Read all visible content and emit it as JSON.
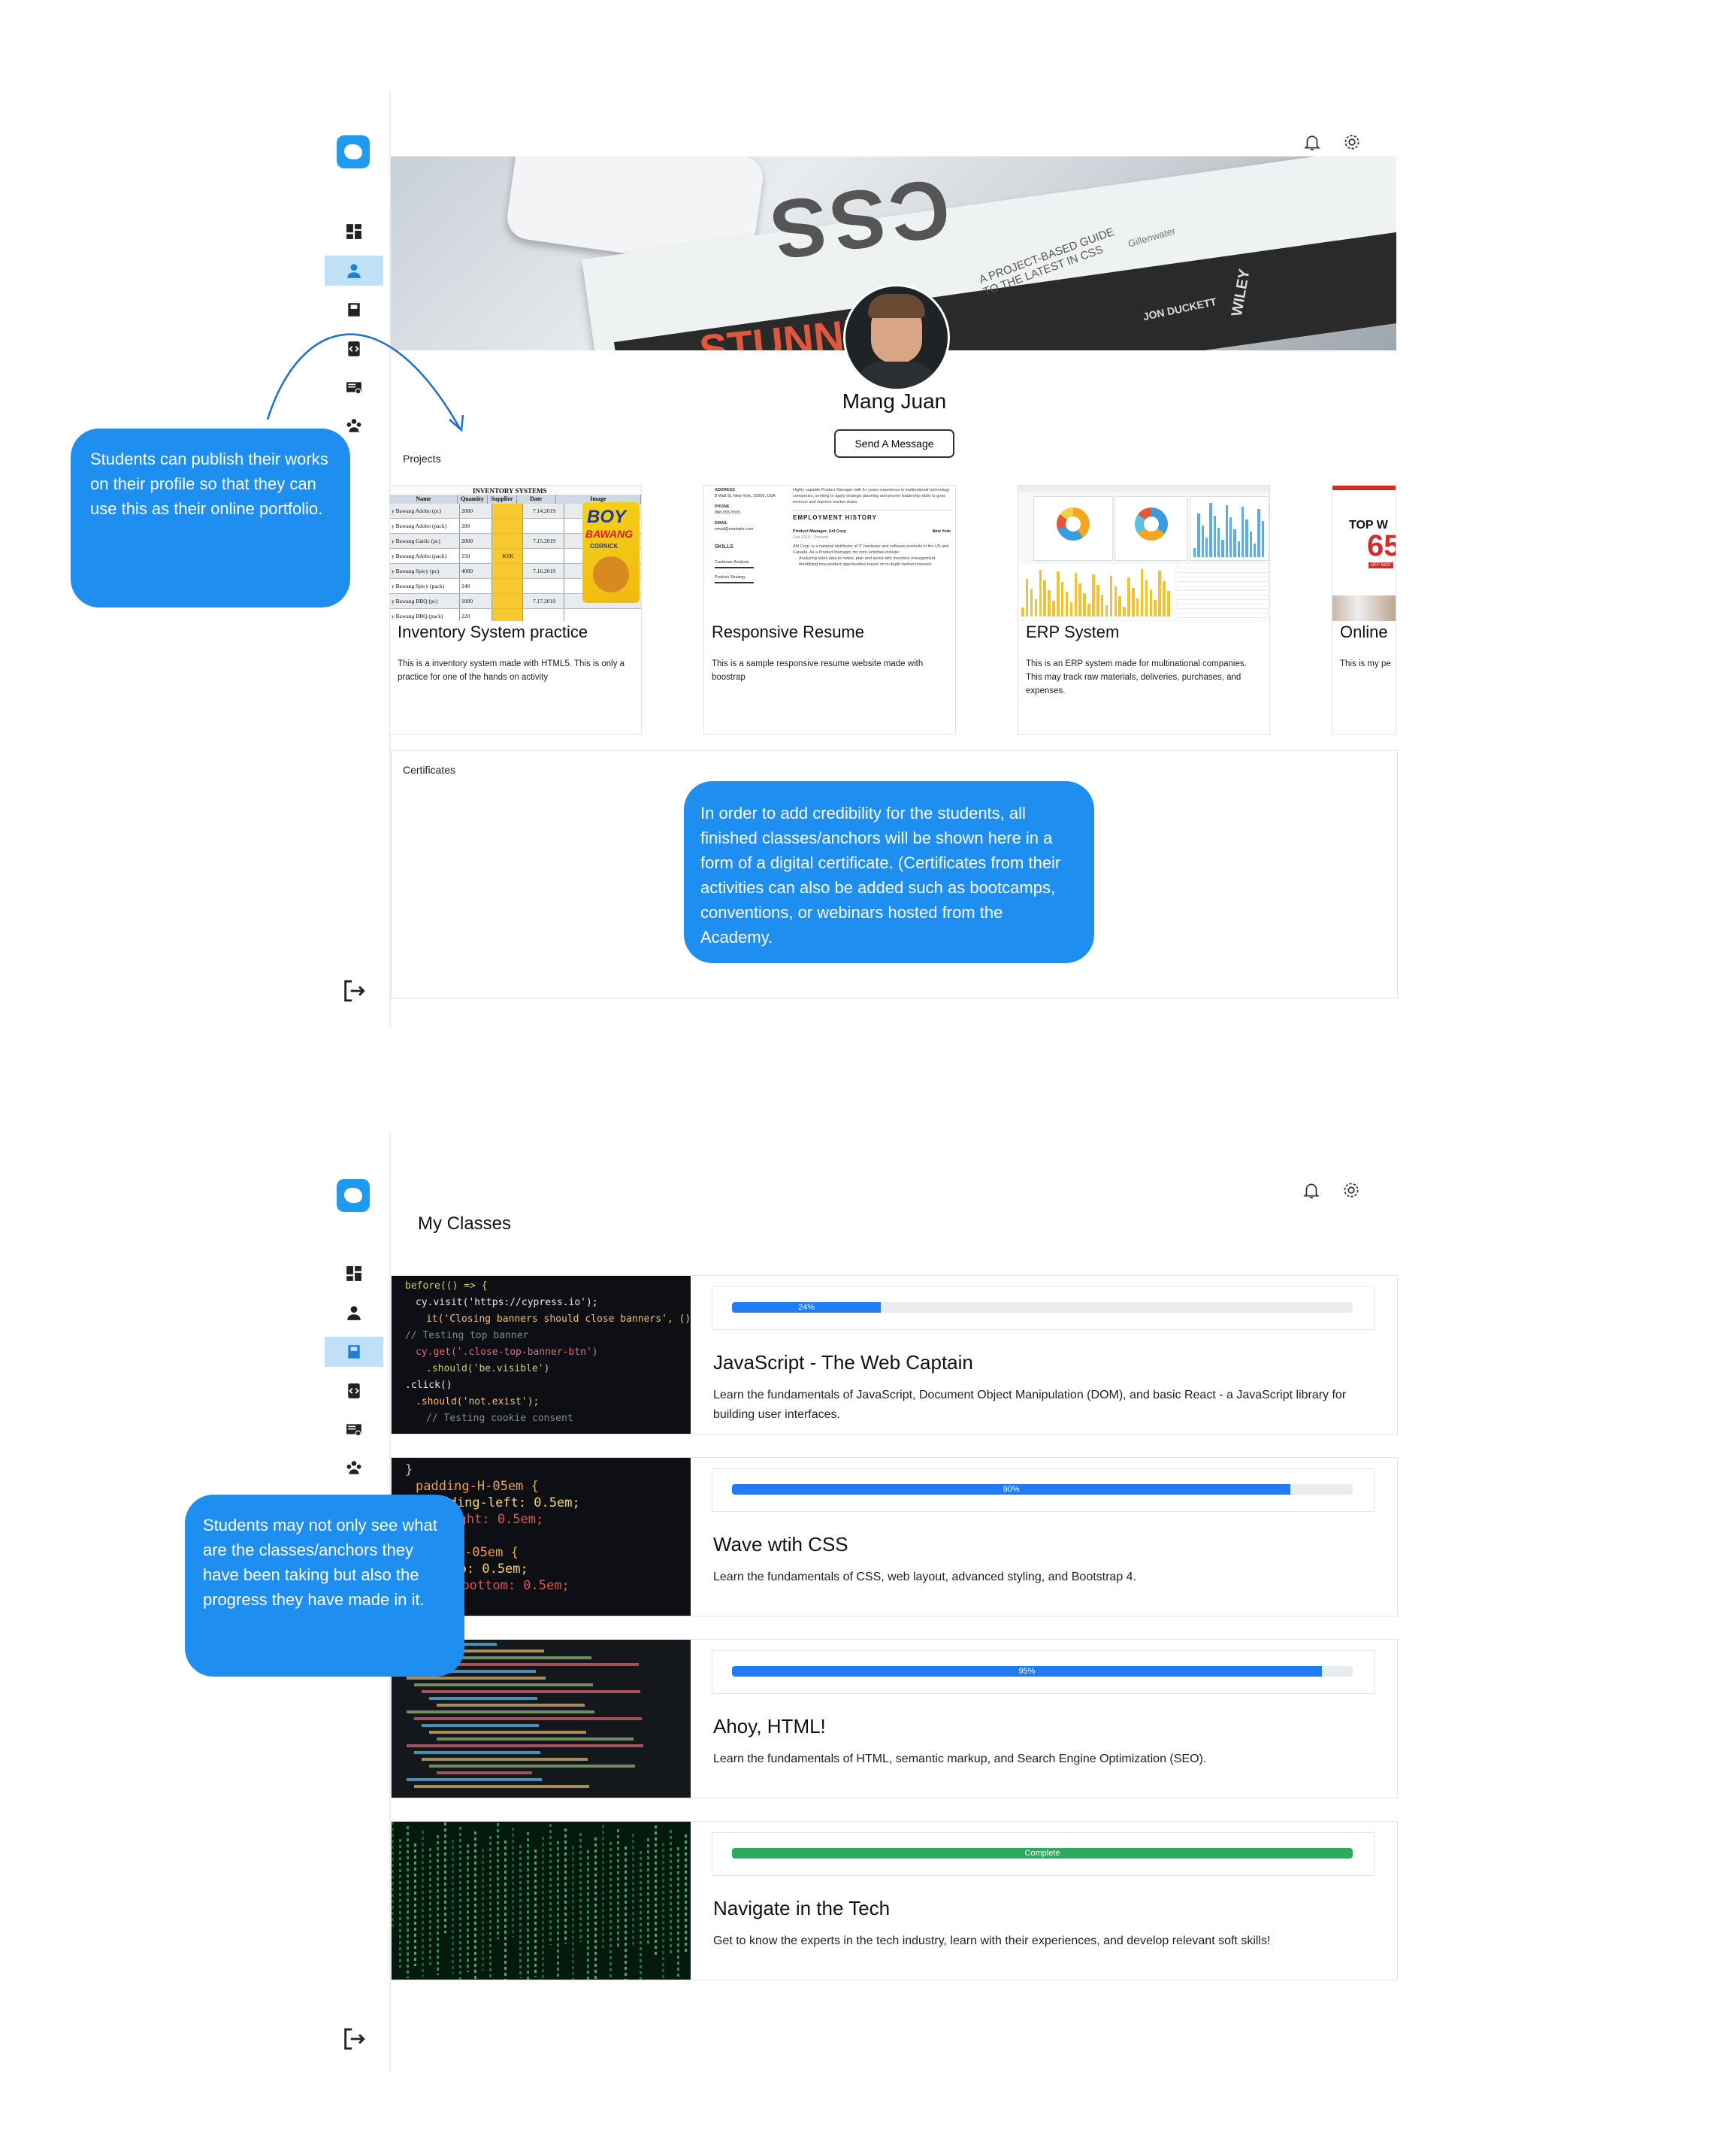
{
  "profile": {
    "name": "Mang Juan",
    "message_button": "Send A Message",
    "projects_label": "Projects",
    "certificates_label": "Certificates",
    "projects": [
      {
        "title": "Inventory System practice",
        "description": "This is a inventory system made with HTML5. This is only a practice for one of the hands on activity"
      },
      {
        "title": "Responsive Resume",
        "description": "This is a sample responsive resume website made with boostrap"
      },
      {
        "title": "ERP System",
        "description": "This is an ERP system made for multinational companies. This may track raw materials, deliveries, purchases, and expenses."
      },
      {
        "title": "Online",
        "description": "This is my pe"
      }
    ]
  },
  "thumbs": {
    "inventory_header": "INVENTORY SYSTEMS",
    "inventory_cols": [
      "Name",
      "Quantity",
      "Supplier",
      "Date",
      "Image"
    ],
    "inventory_rows": [
      [
        "y Bawang Adobo (pc)",
        "2000",
        "",
        "7.14.2019"
      ],
      [
        "y Bawang Adobo (pack)",
        "200",
        "",
        ""
      ],
      [
        "y Bawang Garlic (pc)",
        "2000",
        "",
        "7.15.2019"
      ],
      [
        "y Bawang Adobo (pack)",
        "150",
        "KSK",
        ""
      ],
      [
        "y Bawang Spicy (pc)",
        "4000",
        "",
        "7.16.2019"
      ],
      [
        "y Bawang Spicy (pack)",
        "240",
        "",
        ""
      ],
      [
        "y Bawang BBQ (pc)",
        "1000",
        "",
        "7.17.2019"
      ],
      [
        "y Bawang BBQ (pack)",
        "220",
        "",
        ""
      ]
    ],
    "snack_brand": "BOY",
    "snack_sub": "BAWANG",
    "snack_flavor": "CORNICK",
    "resume_address_label": "ADDRESS",
    "resume_address": "8 Wall St, New York, 10005, USA",
    "resume_phone_label": "PHONE",
    "resume_phone": "888-555-5555",
    "resume_email_label": "EMAIL",
    "resume_email": "email@example.com",
    "resume_skills_label": "SKILLS",
    "resume_skill_1": "Customer Analysis",
    "resume_skill_2": "Product Strategy",
    "resume_summary": "Highly capable Product Manager with 6+ years experience in multinational technology companies, seeking to apply strategic planning and proven leadership skills to grow revenue and improve market share.",
    "resume_history_label": "EMPLOYMENT HISTORY",
    "resume_job": "Product Manager, Aol Corp",
    "resume_city": "New York",
    "resume_dates": "Feb 2018 - Present",
    "resume_job_text": "AM Corp. is a national distributor of IT hardware and software products in the US and Canada. As a Product Manager, my core activities include:",
    "resume_bullet_1": "Analyzing sales data to notice, plan and assist with inventory management.",
    "resume_bullet_2": "Identifying new product opportunities based on in-depth market research.",
    "online_top": "TOP W",
    "online_big": "65",
    "online_off": "OFF NOV"
  },
  "banner": {
    "book_title": "CSS",
    "book_subtitle": "A PROJECT-BASED GUIDE TO THE LATEST IN CSS",
    "book_spine": "STUNNING",
    "publisher": "WILEY",
    "author": "JON DUCKETT",
    "secondary_author": "Gillenwater"
  },
  "callouts": {
    "portfolio": "Students can publish their works on their profile so that they can use this as their online portfolio.",
    "certificates": "In order to add credibility for the students, all finished classes/anchors will be shown here in a form of a digital certificate. (Certificates from their activities can also be added such as bootcamps, conventions, or webinars hosted from the Academy.",
    "classes": "Students may not only see what are the classes/anchors they have been taking but also the progress they have made in it."
  },
  "classes_page": {
    "title": "My Classes",
    "classes": [
      {
        "title": "JavaScript - The Web Captain",
        "description": "Learn the fundamentals of JavaScript, Document Object Manipulation (DOM), and basic React - a JavaScript library for building user interfaces.",
        "progress_label": "24%",
        "progress": 0.24
      },
      {
        "title": "Wave wtih CSS",
        "description": "Learn the fundamentals of CSS, web layout, advanced styling, and Bootstrap 4.",
        "progress_label": "90%",
        "progress": 0.9
      },
      {
        "title": "Ahoy, HTML!",
        "description": "Learn the fundamentals of HTML, semantic markup, and Search Engine Optimization (SEO).",
        "progress_label": "95%",
        "progress": 0.95
      },
      {
        "title": "Navigate in the Tech",
        "description": "Get to know the experts in the tech industry, learn with their experiences, and develop relevant soft skills!",
        "progress_label": "Complete",
        "progress": 1.0
      }
    ]
  },
  "code_js": [
    "before(() => {",
    "cy.visit('https://cypress.io');",
    "it('Closing banners should close banners', () => {",
    "// Testing top banner",
    "cy.get('.close-top-banner-btn')",
    ".should('be.visible')",
    ".click()",
    ".should('not.exist');",
    "// Testing cookie consent"
  ],
  "code_css": [
    "}",
    "padding-H-05em {",
    "padding-left: 0.5em;",
    "ding-right: 0.5em;",
    "",
    "ing-V-05em {",
    "ding-top: 0.5em;",
    "dding-bottom: 0.5em;"
  ],
  "colors": {
    "accent": "#1e8ff0",
    "active_nav": "#bfe0f7",
    "progress": "#1f7cf5",
    "complete": "#2aac5c"
  },
  "icons": [
    "dashboard-icon",
    "profile-icon",
    "classes-icon",
    "anchors-icon",
    "certificates-icon",
    "community-icon",
    "logout-icon",
    "bell-icon",
    "gear-icon"
  ]
}
